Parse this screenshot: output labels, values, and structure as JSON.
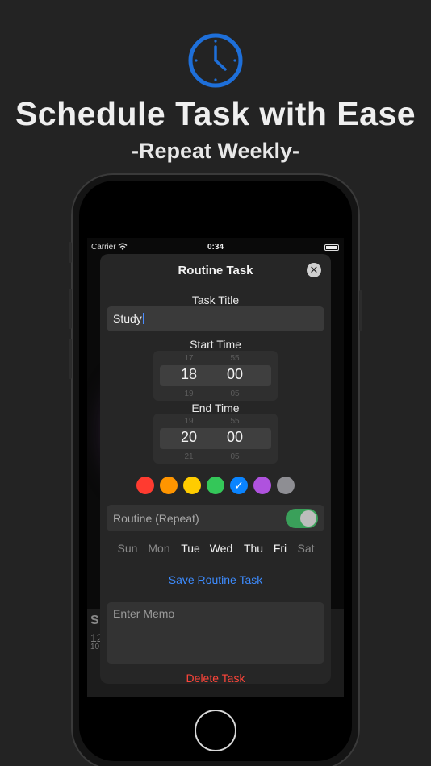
{
  "promo": {
    "title": "Schedule Task with Ease",
    "subtitle": "-Repeat Weekly-",
    "icon": "clock-icon",
    "accent": "#1e6fd9"
  },
  "status_bar": {
    "carrier": "Carrier",
    "time": "0:34"
  },
  "background_screen": {
    "card_initial": "S",
    "card_time": "12",
    "card_sub": "10"
  },
  "modal": {
    "title": "Routine Task",
    "close_label": "✕",
    "task_title_label": "Task Title",
    "task_title_value": "Study",
    "start_time_label": "Start Time",
    "start_time": {
      "hour": "18",
      "minute": "00",
      "hour_above": "17",
      "minute_above": "55",
      "hour_below": "19",
      "minute_below": "05"
    },
    "end_time_label": "End Time",
    "end_time": {
      "hour": "20",
      "minute": "00",
      "hour_above": "19",
      "minute_above": "55",
      "hour_below": "21",
      "minute_below": "05"
    },
    "colors": [
      {
        "name": "red",
        "hex": "#ff3b30",
        "selected": false
      },
      {
        "name": "orange",
        "hex": "#ff9500",
        "selected": false
      },
      {
        "name": "yellow",
        "hex": "#ffcc00",
        "selected": false
      },
      {
        "name": "green",
        "hex": "#34c759",
        "selected": false
      },
      {
        "name": "blue",
        "hex": "#0a84ff",
        "selected": true
      },
      {
        "name": "purple",
        "hex": "#af52de",
        "selected": false
      },
      {
        "name": "gray",
        "hex": "#8e8e93",
        "selected": false
      }
    ],
    "routine_label": "Routine (Repeat)",
    "routine_on": true,
    "days": [
      {
        "label": "Sun",
        "active": false
      },
      {
        "label": "Mon",
        "active": false
      },
      {
        "label": "Tue",
        "active": true
      },
      {
        "label": "Wed",
        "active": true
      },
      {
        "label": "Thu",
        "active": true
      },
      {
        "label": "Fri",
        "active": true
      },
      {
        "label": "Sat",
        "active": false
      }
    ],
    "save_label": "Save Routine Task",
    "memo_placeholder": "Enter Memo",
    "delete_label": "Delete Task"
  }
}
